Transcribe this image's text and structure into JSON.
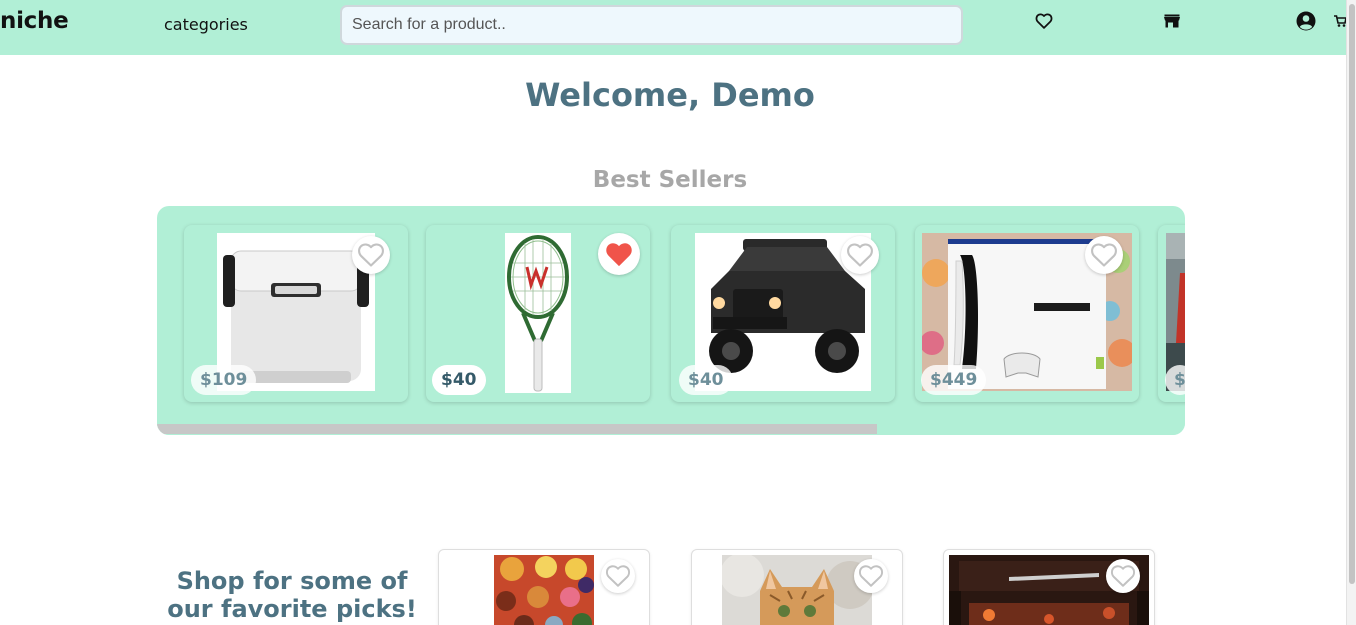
{
  "nav": {
    "logo": "niche",
    "categories_label": "categories",
    "search_placeholder": "Search for a product..",
    "icons": [
      "heart-icon",
      "store-icon",
      "account-icon",
      "cart-icon"
    ]
  },
  "welcome": "Welcome, Demo",
  "best_sellers": {
    "title": "Best Sellers",
    "items": [
      {
        "product": "cooler",
        "price": "$109",
        "favorited": false
      },
      {
        "product": "tennis-racket",
        "price": "$40",
        "favorited": true
      },
      {
        "product": "ride-on-jeep",
        "price": "$40",
        "favorited": false
      },
      {
        "product": "ps5-console",
        "price": "$449",
        "favorited": false
      },
      {
        "product": "partial-product",
        "price": "$",
        "favorited": false
      }
    ]
  },
  "picks": {
    "title": "Shop for some of our favorite picks!",
    "items": [
      {
        "product": "charcuterie-board",
        "favorited": false
      },
      {
        "product": "cat-painting",
        "favorited": false
      },
      {
        "product": "desk-setup",
        "favorited": false
      }
    ]
  },
  "colors": {
    "nav_bg": "#b1efd6",
    "heading": "#4d7282",
    "muted_heading": "#a7a7a7",
    "favorite_red": "#f0544a"
  }
}
